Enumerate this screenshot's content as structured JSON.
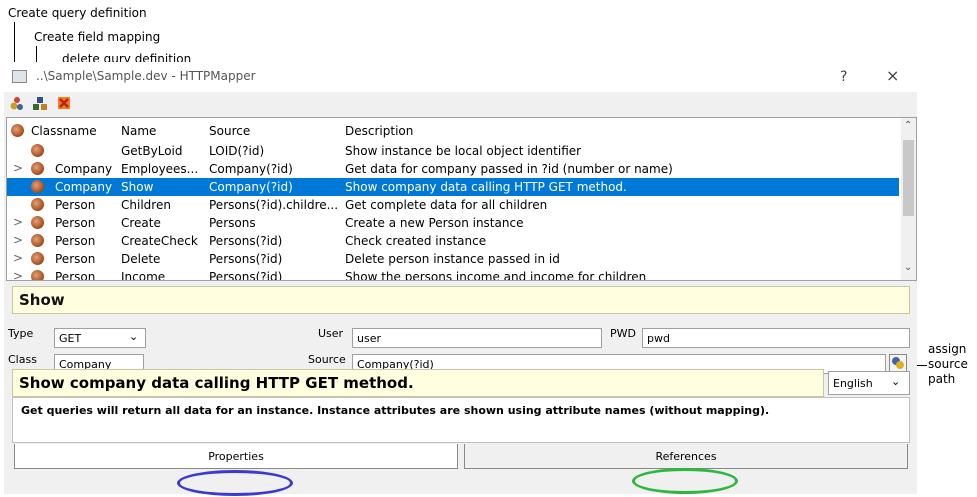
{
  "callouts": {
    "create_query": "Create query definition",
    "create_field_mapping": "Create field mapping",
    "delete_query": "delete qury definition",
    "assign_source_path": [
      "assign",
      "source",
      "path"
    ]
  },
  "window": {
    "title": "..\\Sample\\Sample.dev - HTTPMapper",
    "help": "?",
    "close": "×"
  },
  "list": {
    "columns": [
      "Classname",
      "Name",
      "Source",
      "Description"
    ],
    "rows": [
      {
        "chevron": "",
        "classname": "",
        "name": "GetByLoid",
        "source": "LOID(?id)",
        "description": "Show instance be local object identifier"
      },
      {
        "chevron": ">",
        "classname": "Company",
        "name": "Employees...",
        "source": "Company(?id)",
        "description": "Get data for company passed in ?id (number or name)"
      },
      {
        "chevron": "",
        "classname": "Company",
        "name": "Show",
        "source": "Company(?id)",
        "description": "Show company data calling HTTP GET method.",
        "selected": true
      },
      {
        "chevron": "",
        "classname": "Person",
        "name": "Children",
        "source": "Persons(?id).childre...",
        "description": "Get complete data for all children"
      },
      {
        "chevron": ">",
        "classname": "Person",
        "name": "Create",
        "source": "Persons",
        "description": "Create a new Person instance"
      },
      {
        "chevron": ">",
        "classname": "Person",
        "name": "CreateCheck",
        "source": "Persons(?id)",
        "description": "Check created instance"
      },
      {
        "chevron": ">",
        "classname": "Person",
        "name": "Delete",
        "source": "Persons(?id)",
        "description": "Delete person instance passed in id"
      },
      {
        "chevron": ">",
        "classname": "Person",
        "name": "Income",
        "source": "Persons(?id)",
        "description": "Show the persons income and income for children"
      }
    ]
  },
  "details": {
    "title": "Show",
    "type_label": "Type",
    "type_value": "GET",
    "user_label": "User",
    "user_value": "user",
    "pwd_label": "PWD",
    "pwd_value": "pwd",
    "class_label": "Class",
    "class_value": "Company",
    "source_label": "Source",
    "source_value": "Company(?id)",
    "description_title": "Show company data calling HTTP GET method.",
    "language": "English",
    "description_body": "Get queries will return all data for an instance. Instance attributes are shown using attribute names (without mapping)."
  },
  "tabs": [
    "Properties",
    "References"
  ],
  "colors": {
    "selection": "#0078d7",
    "highlight_blue": "#3a3ad0",
    "highlight_green": "#2db83d",
    "yellow_bg": "#ffffe0"
  }
}
